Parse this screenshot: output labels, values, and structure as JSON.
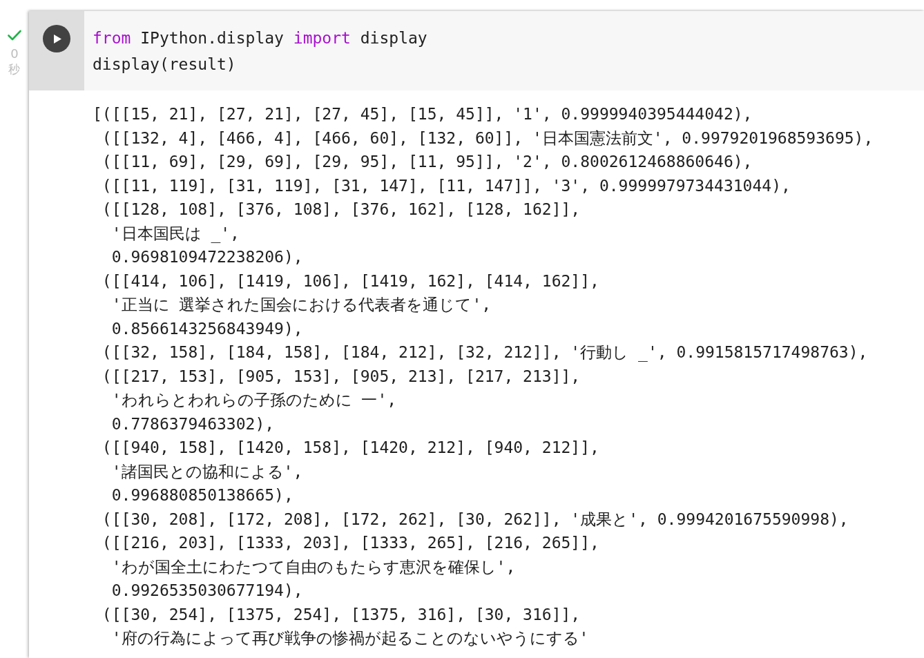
{
  "cell": {
    "run_succeeded": true,
    "execution_time": "0",
    "time_unit": "秒",
    "code_lines": [
      {
        "tokens": [
          {
            "kind": "keyword",
            "text": "from"
          },
          {
            "kind": "plain",
            "text": " IPython.display "
          },
          {
            "kind": "keyword",
            "text": "import"
          },
          {
            "kind": "plain",
            "text": " display"
          }
        ]
      },
      {
        "tokens": [
          {
            "kind": "plain",
            "text": "display(result)"
          }
        ]
      }
    ],
    "output_lines": [
      {
        "kind": "start",
        "text": "[([[15, 21], [27, 21], [27, 45], [15, 45]], '1', 0.9999940395444042),"
      },
      {
        "kind": "item",
        "text": "([[132, 4], [466, 4], [466, 60], [132, 60]], '日本国憲法前文', 0.9979201968593695),"
      },
      {
        "kind": "item",
        "text": "([[11, 69], [29, 69], [29, 95], [11, 95]], '2', 0.8002612468860646),"
      },
      {
        "kind": "item",
        "text": "([[11, 119], [31, 119], [31, 147], [11, 147]], '3', 0.9999979734431044),"
      },
      {
        "kind": "item",
        "text": "([[128, 108], [376, 108], [376, 162], [128, 162]],"
      },
      {
        "kind": "continuation",
        "text": "'日本国民は _',"
      },
      {
        "kind": "continuation",
        "text": "0.9698109472238206),"
      },
      {
        "kind": "item",
        "text": "([[414, 106], [1419, 106], [1419, 162], [414, 162]],"
      },
      {
        "kind": "continuation",
        "text": "'正当に 選挙された国会における代表者を通じて',"
      },
      {
        "kind": "continuation",
        "text": "0.8566143256843949),"
      },
      {
        "kind": "item",
        "text": "([[32, 158], [184, 158], [184, 212], [32, 212]], '行動し _', 0.9915815717498763),"
      },
      {
        "kind": "item",
        "text": "([[217, 153], [905, 153], [905, 213], [217, 213]],"
      },
      {
        "kind": "continuation",
        "text": "'われらとわれらの子孫のために 一',"
      },
      {
        "kind": "continuation",
        "text": "0.7786379463302),"
      },
      {
        "kind": "item",
        "text": "([[940, 158], [1420, 158], [1420, 212], [940, 212]],"
      },
      {
        "kind": "continuation",
        "text": "'諸国民との協和による',"
      },
      {
        "kind": "continuation",
        "text": "0.996880850138665),"
      },
      {
        "kind": "item",
        "text": "([[30, 208], [172, 208], [172, 262], [30, 262]], '成果と', 0.9994201675590998),"
      },
      {
        "kind": "item",
        "text": "([[216, 203], [1333, 203], [1333, 265], [216, 265]],"
      },
      {
        "kind": "continuation",
        "text": "'わが国全土にわたつて自由のもたらす恵沢を確保し',"
      },
      {
        "kind": "continuation",
        "text": "0.9926535030677194),"
      },
      {
        "kind": "item",
        "text": "([[30, 254], [1375, 254], [1375, 316], [30, 316]],"
      },
      {
        "kind": "continuation",
        "text": "'府の行為によって再び戦争の惨禍が起ることのないやうにする'"
      }
    ]
  }
}
